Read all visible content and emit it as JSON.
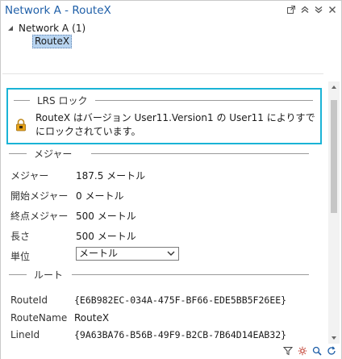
{
  "window": {
    "title": "Network A - RouteX",
    "icons": [
      "popout-icon",
      "chevron-up-icon",
      "chevron-down-icon",
      "close-icon"
    ]
  },
  "tree": {
    "node_label": "Network A",
    "node_count": "(1)",
    "child_label": "RouteX"
  },
  "lock_section": {
    "title": "LRS ロック",
    "message": "RouteX はバージョン User11.Version1 の User11 によりすでにロックされています。",
    "icon": "lock-warning-icon",
    "border_color": "#1ab3d6"
  },
  "measure_section": {
    "title": "メジャー",
    "rows": [
      {
        "label": "メジャー",
        "value": "187.5 メートル"
      },
      {
        "label": "開始メジャー",
        "value": "0 メートル"
      },
      {
        "label": "終点メジャー",
        "value": "500 メートル"
      },
      {
        "label": "長さ",
        "value": "500 メートル"
      }
    ],
    "unit_label": "単位",
    "unit_value": "メートル"
  },
  "route_section": {
    "title": "ルート",
    "rows": [
      {
        "label": "RouteId",
        "value": "{E6B982EC-034A-475F-BF66-EDE5BB5F26EE}"
      },
      {
        "label": "RouteName",
        "value": "RouteX"
      },
      {
        "label": "LineId",
        "value": "{9A63BA76-B56B-49F9-B2CB-7B64D14EAB32}"
      }
    ]
  },
  "bottom_icons": [
    "filter-icon",
    "settings-icon",
    "zoom-icon",
    "refresh-icon"
  ],
  "colors": {
    "title": "#1f5fa8",
    "selection": "#b8d4f0",
    "accent_border": "#1ab3d6"
  }
}
